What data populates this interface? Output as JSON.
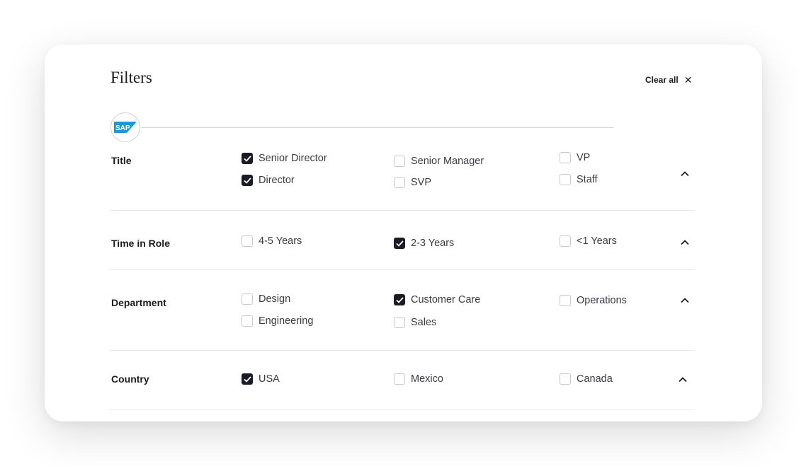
{
  "header": {
    "title": "Filters",
    "clear_all_label": "Clear all",
    "clear_icon": "close-icon"
  },
  "company": {
    "logo_text": "SAP",
    "logo_color": "#1a9ad6"
  },
  "colors": {
    "checked": "#1b1b26",
    "border": "#c7c9cd",
    "divider": "#e7e8ea"
  },
  "sections": [
    {
      "title": "Title",
      "options": [
        {
          "label": "Senior Director",
          "checked": true
        },
        {
          "label": "Director",
          "checked": true
        },
        {
          "label": "Senior Manager",
          "checked": false
        },
        {
          "label": "SVP",
          "checked": false
        },
        {
          "label": "VP",
          "checked": false
        },
        {
          "label": "Staff",
          "checked": false
        }
      ]
    },
    {
      "title": "Time in Role",
      "options": [
        {
          "label": "4-5 Years",
          "checked": false
        },
        {
          "label": "2-3 Years",
          "checked": true
        },
        {
          "label": "<1 Years",
          "checked": false
        }
      ]
    },
    {
      "title": "Department",
      "options": [
        {
          "label": "Design",
          "checked": false
        },
        {
          "label": "Engineering",
          "checked": false
        },
        {
          "label": "Customer Care",
          "checked": true
        },
        {
          "label": "Sales",
          "checked": false
        },
        {
          "label": "Operations",
          "checked": false
        }
      ]
    },
    {
      "title": "Country",
      "options": [
        {
          "label": "USA",
          "checked": true
        },
        {
          "label": "Mexico",
          "checked": false
        },
        {
          "label": "Canada",
          "checked": false
        }
      ]
    }
  ]
}
